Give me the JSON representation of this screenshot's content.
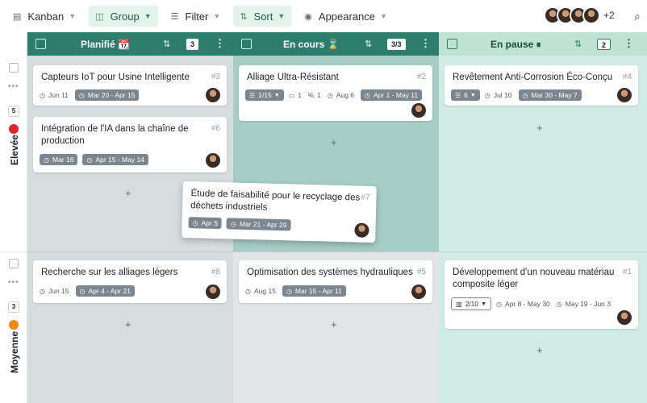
{
  "toolbar": {
    "kanban": "Kanban",
    "group": "Group",
    "filter": "Filter",
    "sort": "Sort",
    "appearance": "Appearance",
    "more_users": "+2"
  },
  "columns": [
    {
      "title": "Planifié 📆",
      "count": "3"
    },
    {
      "title": "En cours ⌛",
      "count": "3/3"
    },
    {
      "title": "En pause ⏸",
      "count": "2"
    }
  ],
  "rows": [
    {
      "label": "Elevée",
      "count": "5",
      "color": "#e0262b"
    },
    {
      "label": "Moyenne",
      "count": "3",
      "color": "#f08a16"
    }
  ],
  "cards": {
    "c3": {
      "title": "Capteurs IoT pour Usine Intelligente",
      "num": "#3",
      "date": "Jun 11",
      "range": "Mar 20 - Apr 15"
    },
    "c6": {
      "title": "Intégration de l'IA dans la chaîne de production",
      "num": "#6",
      "date": "Mar 16",
      "range": "Apr 15 - May 14"
    },
    "c2": {
      "title": "Alliage Ultra-Résistant",
      "num": "#2",
      "progress": "1/15",
      "comments": "1",
      "attach": "1",
      "date": "Aug 6",
      "range": "Apr 1 - May 11"
    },
    "c4": {
      "title": "Revêtement Anti-Corrosion Éco-Conçu",
      "num": "#4",
      "progress": "6",
      "date": "Jul 10",
      "range": "Mar 30 - May 7"
    },
    "c7": {
      "title": "Étude de faisabilité pour le recyclage des déchets industriels",
      "num": "#7",
      "date": "Apr 5",
      "range": "Mar 21 - Apr 29"
    },
    "c8": {
      "title": "Recherche sur les alliages légers",
      "num": "#8",
      "date": "Jun 15",
      "range": "Apr 4 - Apr 21"
    },
    "c5": {
      "title": "Optimisation des systèmes hydrauliques",
      "num": "#5",
      "date": "Aug 15",
      "range": "Mar 15 - Apr 11"
    },
    "c1": {
      "title": "Développement d'un nouveau matériau composite léger",
      "num": "#1",
      "progress": "2/10",
      "range1": "Apr 8 - May 30",
      "range2": "May 19 - Jun 3"
    }
  },
  "colors": {
    "header": "#2d7d6c",
    "header_paused": "#bfe3d3",
    "col1_bg": "#d7dcde",
    "col2_bg": "#a6cdc6",
    "col3_bg": "#d1ebe5"
  }
}
